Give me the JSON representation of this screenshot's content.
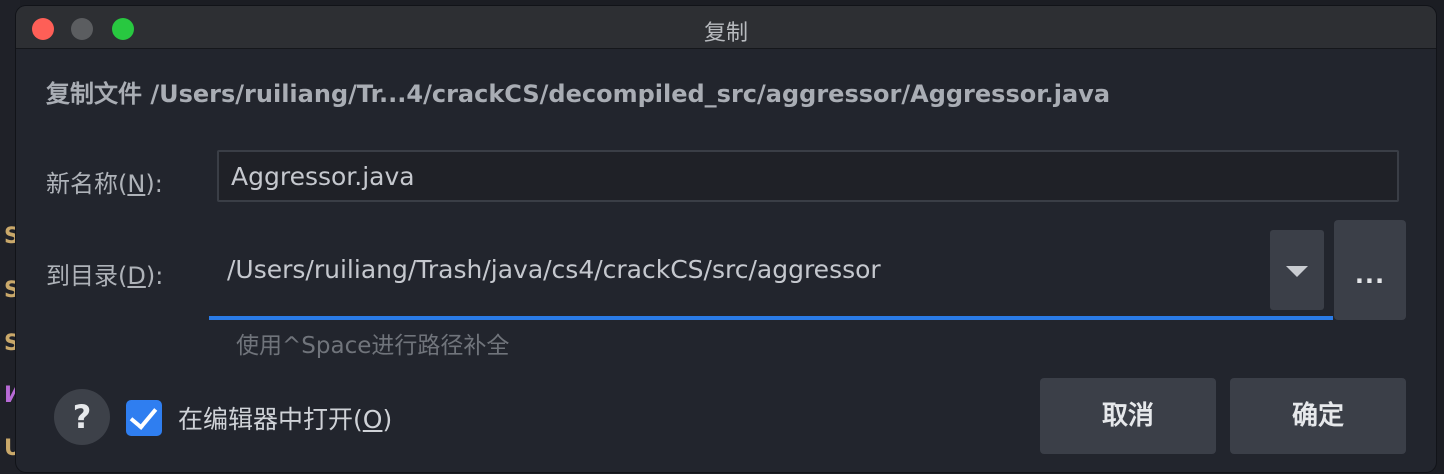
{
  "window": {
    "title": "复制"
  },
  "header": {
    "text": "复制文件 /Users/ruiliang/Tr...4/crackCS/decompiled_src/aggressor/Aggressor.java"
  },
  "new_name": {
    "label": "新名称(",
    "mnemonic": "N",
    "label_suffix": "):",
    "value": "Aggressor.java"
  },
  "target_dir": {
    "label": "到目录(",
    "mnemonic": "D",
    "label_suffix": "):",
    "value": "/Users/ruiliang/Trash/java/cs4/crackCS/src/aggressor",
    "browse_label": "...",
    "hint": "使用^Space进行路径补全"
  },
  "open_in_editor": {
    "label": "在编辑器中打开(",
    "mnemonic": "O",
    "label_suffix": ")",
    "checked": true
  },
  "help": {
    "label": "?"
  },
  "buttons": {
    "cancel": "取消",
    "ok": "确定"
  },
  "editor_gutter": {
    "glyphs": [
      "S",
      "S",
      "S",
      "И",
      "U"
    ],
    "colors": [
      "#c9a86a",
      "#c9a86a",
      "#c9a86a",
      "#b86ad6",
      "#c9a86a"
    ]
  },
  "colors": {
    "accent": "#2a7be6",
    "checkbox": "#2f7ef0",
    "close": "#fe5f57",
    "maximize": "#28c840",
    "minimize": "#5b5d60"
  }
}
